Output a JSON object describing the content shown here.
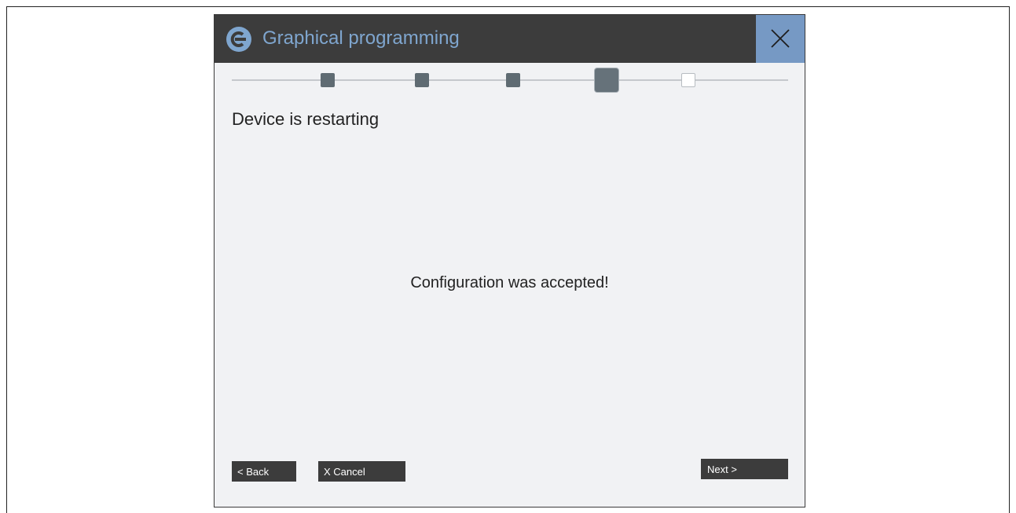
{
  "window": {
    "title": "Graphical programming",
    "app_icon": "app-logo-icon",
    "close_icon": "close-icon",
    "accent_color": "#7699c4",
    "titlebar_color": "#3c3c3c"
  },
  "wizard": {
    "steps": [
      {
        "state": "done"
      },
      {
        "state": "done"
      },
      {
        "state": "done"
      },
      {
        "state": "current"
      },
      {
        "state": "todo"
      }
    ],
    "heading": "Device is restarting",
    "message": "Configuration was accepted!"
  },
  "buttons": {
    "back": "< Back",
    "cancel": "X Cancel",
    "next": "Next  >"
  }
}
